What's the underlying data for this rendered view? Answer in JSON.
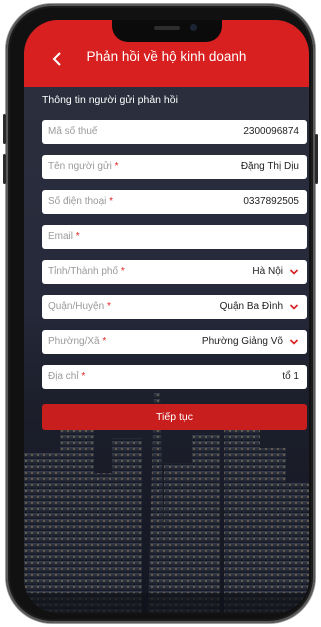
{
  "header": {
    "title": "Phản hồi về hộ kinh doanh",
    "back_icon": "chevron-left-icon"
  },
  "section": {
    "label": "Thông tin người gửi phản hồi"
  },
  "form": {
    "tax_code": {
      "label": "Mã số thuế",
      "required": "",
      "value": "2300096874"
    },
    "sender_name": {
      "label": "Tên người gửi",
      "required": "*",
      "value": "Đặng Thị Dịu"
    },
    "phone": {
      "label": "Số điện thoại",
      "required": "*",
      "value": "0337892505"
    },
    "email": {
      "label": "Email",
      "required": "*",
      "value": ""
    },
    "province": {
      "label": "Tỉnh/Thành phố",
      "required": "*",
      "value": "Hà Nội"
    },
    "district": {
      "label": "Quận/Huyện",
      "required": "*",
      "value": "Quận Ba Đình"
    },
    "ward": {
      "label": "Phường/Xã",
      "required": "*",
      "value": "Phường Giảng Võ"
    },
    "address": {
      "label": "Địa chỉ",
      "required": "*",
      "value": "tổ 1"
    }
  },
  "actions": {
    "continue_label": "Tiếp tục"
  },
  "colors": {
    "accent": "#d7201f",
    "required": "#e0241f",
    "button": "#c81e1e"
  }
}
